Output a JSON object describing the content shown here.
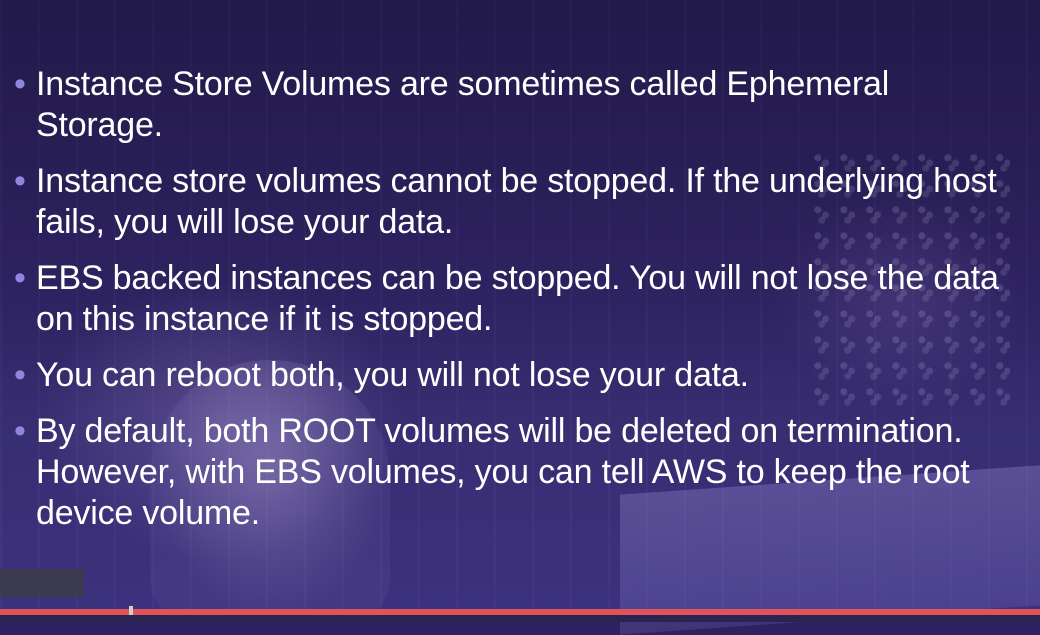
{
  "slide": {
    "bullets": [
      "Instance Store Volumes are sometimes called Ephemeral Storage.",
      "Instance store volumes cannot be stopped. If the underlying host fails, you will lose your data.",
      "EBS backed instances can be stopped. You will not lose the data on this instance if it is stopped.",
      "You can reboot both, you will not lose your data.",
      "By default, both ROOT volumes will be deleted on termination. However, with EBS volumes, you can tell AWS to keep the root device volume."
    ],
    "bullet_glyph": "•",
    "colors": {
      "text": "#ffffff",
      "bullet": "#8f86e0",
      "background": "#2d2160"
    }
  },
  "player": {
    "progress": 0.124,
    "progress_color": "#e1525b"
  }
}
